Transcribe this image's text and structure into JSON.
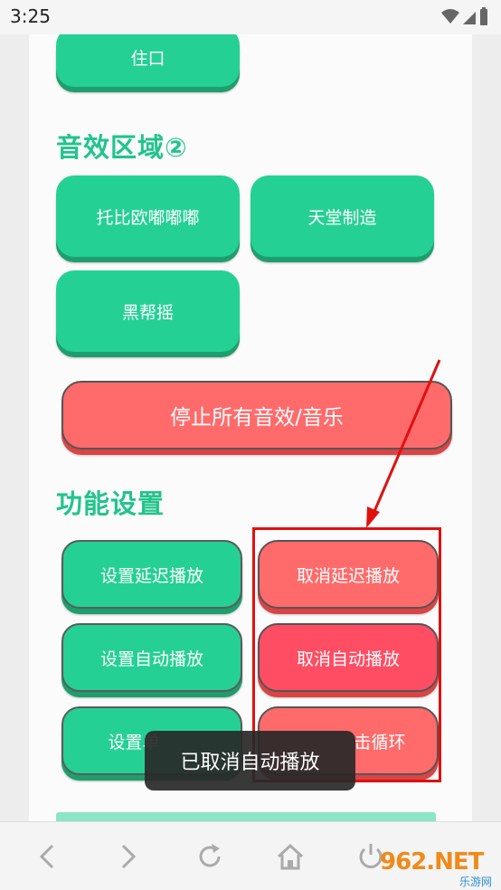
{
  "status": {
    "time": "3:25"
  },
  "buttons": {
    "top_partial": "住口",
    "tuobiou": "托比欧嘟嘟嘟",
    "tiantang": "天堂制造",
    "heibang": "黑帮摇",
    "stop_all": "停止所有音效/音乐",
    "set_delay": "设置延迟播放",
    "cancel_delay": "取消延迟播放",
    "set_auto": "设置自动播放",
    "cancel_auto": "取消自动播放",
    "set_single_partial": "设置单",
    "cancel_loop_partial": "击循环"
  },
  "sections": {
    "sound2": "音效区域②",
    "settings": "功能设置"
  },
  "toast": "已取消自动播放",
  "watermark": {
    "main": "962.NET",
    "sub": "乐游网"
  },
  "colors": {
    "green": "#25d094",
    "red": "#ff6b6b",
    "title_green": "#22c48b"
  }
}
